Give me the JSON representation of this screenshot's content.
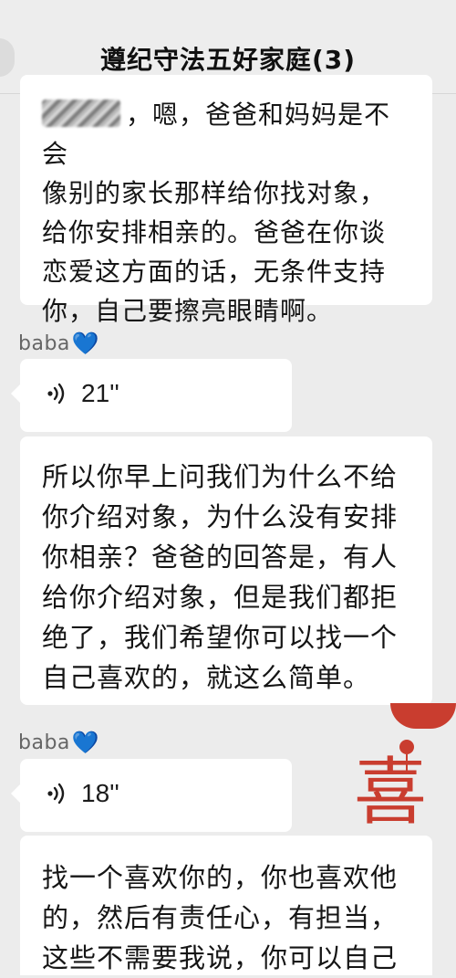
{
  "header": {
    "title": "遵纪守法五好家庭(3)"
  },
  "messages": {
    "top_text": "，嗯，爸爸和妈妈是不会\n像别的家长那样给你找对象，\n给你安排相亲的。爸爸在你谈\n恋爱这方面的话，无条件支持\n你，自己要擦亮眼睛啊。",
    "sender_1": "baba",
    "voice_1_duration": "21''",
    "mid_text": "所以你早上问我们为什么不给\n你介绍对象，为什么没有安排\n你相亲？爸爸的回答是，有人\n给你介绍对象，但是我们都拒\n绝了，我们希望你可以找一个\n自己喜欢的，就这么简单。",
    "sender_2": "baba",
    "voice_2_duration": "18''",
    "bottom_text": "找一个喜欢你的，你也喜欢他\n的，然后有责任心，有担当，\n这些不需要我说，你可以自己"
  },
  "decor": {
    "glyph": "喜"
  },
  "icons": {
    "heart": "💙",
    "voice": "voice-wave-icon"
  },
  "colors": {
    "background": "#ececec",
    "bubble": "#ffffff",
    "heart": "#2f86f6",
    "decor_red": "#c93d2f"
  }
}
